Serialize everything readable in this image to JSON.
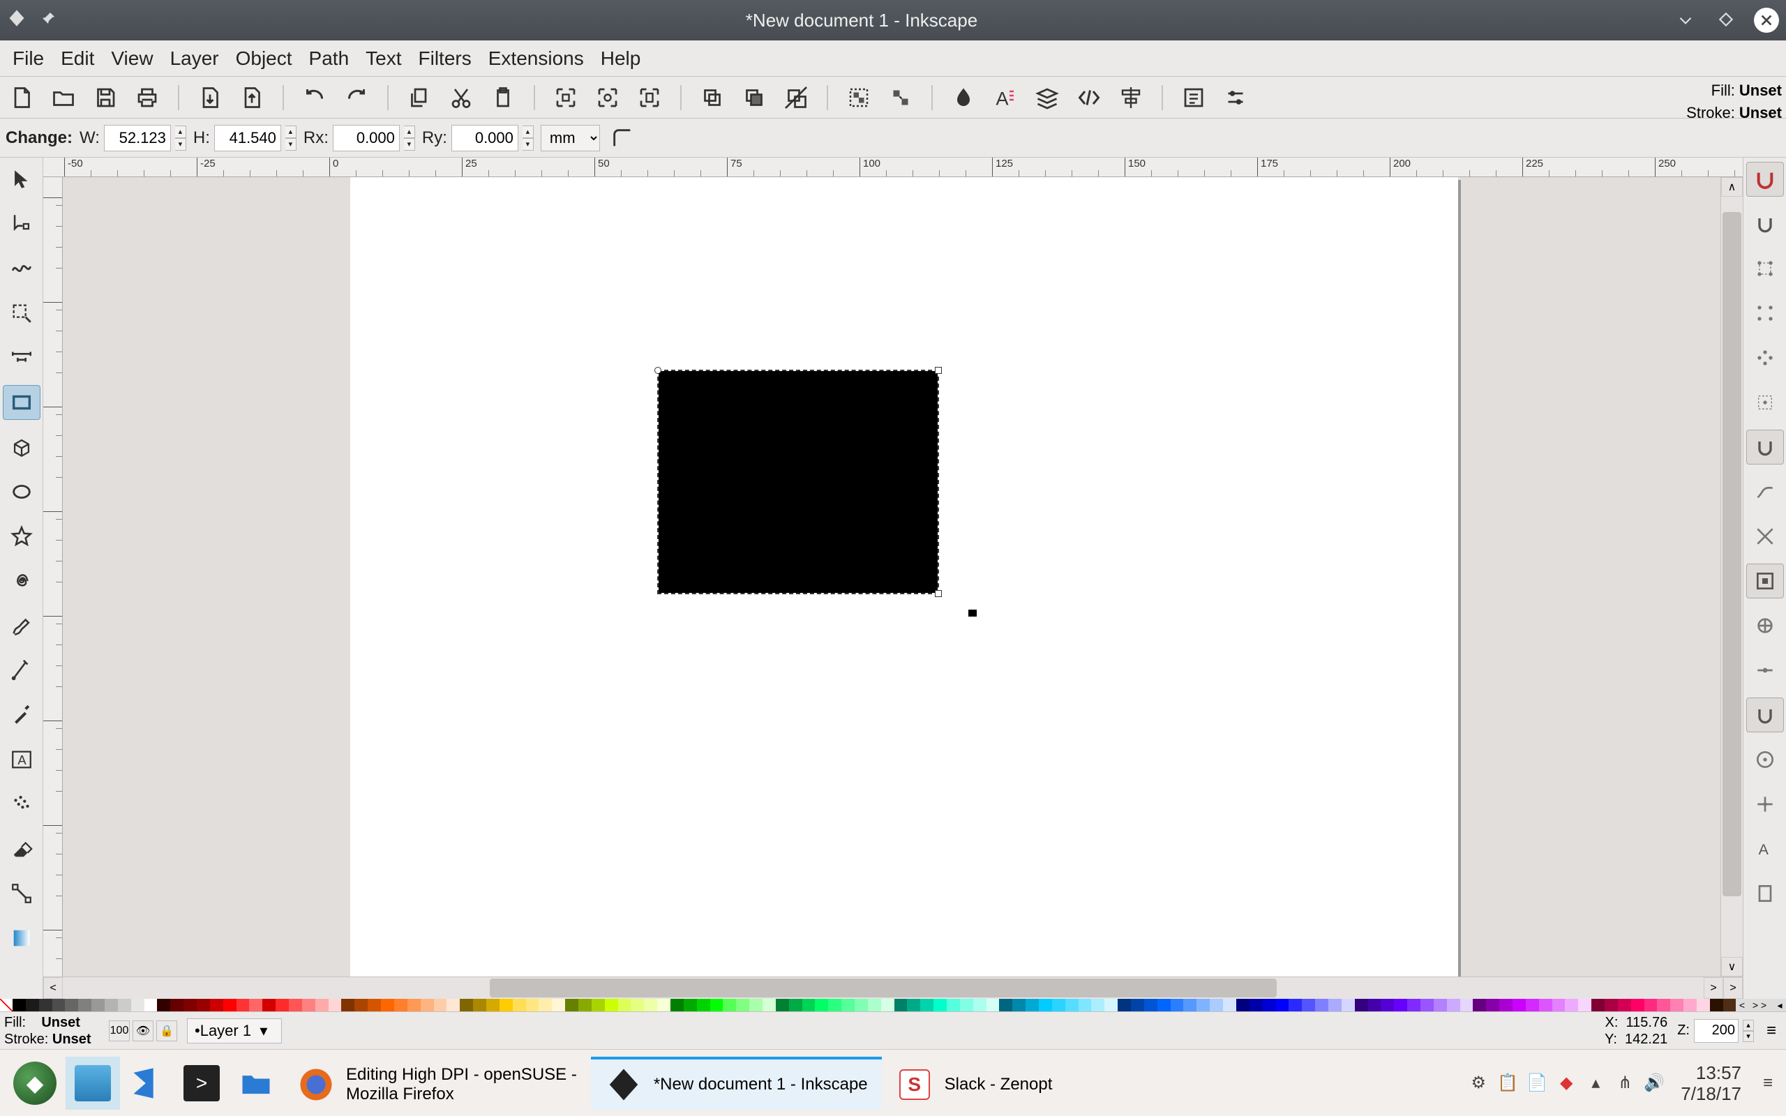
{
  "title": "*New document 1 - Inkscape",
  "menus": [
    "File",
    "Edit",
    "View",
    "Layer",
    "Object",
    "Path",
    "Text",
    "Filters",
    "Extensions",
    "Help"
  ],
  "options": {
    "change": "Change:",
    "w_lbl": "W:",
    "w": "52.123",
    "h_lbl": "H:",
    "h": "41.540",
    "rx_lbl": "Rx:",
    "rx": "0.000",
    "ry_lbl": "Ry:",
    "ry": "0.000",
    "unit": "mm"
  },
  "fill_lbl": "Fill:",
  "stroke_lbl": "Stroke:",
  "unset": "Unset",
  "status": {
    "fill_lbl": "Fill:",
    "fill": "Unset",
    "stroke_lbl": "Stroke:",
    "stroke": "Unset",
    "opacity": "100",
    "layer": "•Layer 1",
    "x_lbl": "X:",
    "x": "115.76",
    "y_lbl": "Y:",
    "y": "142.21",
    "z_lbl": "Z:",
    "z": "200"
  },
  "taskbar": {
    "firefox_l1": "Editing High DPI - openSUSE -",
    "firefox_l2": "Mozilla Firefox",
    "inkscape": "*New document 1 - Inkscape",
    "slack": "Slack - Zenopt",
    "time": "13:57",
    "date": "7/18/17"
  },
  "ruler_h": [
    "-50",
    "-25",
    "0",
    "25",
    "50",
    "75",
    "100",
    "125",
    "150",
    "175",
    "200",
    "225",
    "250"
  ],
  "palette_hex": [
    "#000000",
    "#1a1a1a",
    "#333333",
    "#4d4d4d",
    "#666666",
    "#808080",
    "#999999",
    "#b3b3b3",
    "#cccccc",
    "#e6e6e6",
    "#ffffff",
    "#330000",
    "#660000",
    "#800000",
    "#990000",
    "#cc0000",
    "#ff0000",
    "#ff3333",
    "#ff6666",
    "#d40000",
    "#ff2a2a",
    "#ff5555",
    "#ff8080",
    "#ffaaaa",
    "#ffd5d5",
    "#803300",
    "#aa4400",
    "#d45500",
    "#ff6600",
    "#ff7f2a",
    "#ff9955",
    "#ffb380",
    "#ffccaa",
    "#ffe6d5",
    "#806600",
    "#aa8800",
    "#d4aa00",
    "#ffcc00",
    "#ffdd55",
    "#ffe680",
    "#ffeeaa",
    "#fff6d5",
    "#668000",
    "#88aa00",
    "#aad400",
    "#ccff00",
    "#ddff55",
    "#e5ff80",
    "#eeffaa",
    "#f6ffd5",
    "#008000",
    "#00aa00",
    "#00d400",
    "#00ff00",
    "#55ff55",
    "#80ff80",
    "#aaffaa",
    "#d5ffd5",
    "#008033",
    "#00aa44",
    "#00d455",
    "#00ff66",
    "#2aff80",
    "#55ff99",
    "#80ffb3",
    "#aaffcc",
    "#d5ffe6",
    "#008066",
    "#00aa88",
    "#00d4aa",
    "#00ffcc",
    "#55ffdd",
    "#80ffe6",
    "#aaffee",
    "#d5fff6",
    "#006680",
    "#0088aa",
    "#00aad4",
    "#00ccff",
    "#2ad4ff",
    "#55ddff",
    "#80e5ff",
    "#aaeeff",
    "#d5f6ff",
    "#003380",
    "#0044aa",
    "#0055d4",
    "#0066ff",
    "#2a7fff",
    "#5599ff",
    "#80b3ff",
    "#aaccff",
    "#d5e5ff",
    "#000080",
    "#0000aa",
    "#0000d4",
    "#0000ff",
    "#2a2aff",
    "#5555ff",
    "#8080ff",
    "#aaaaff",
    "#d5d5ff",
    "#330080",
    "#4400aa",
    "#5500d4",
    "#6600ff",
    "#7f2aff",
    "#9955ff",
    "#b380ff",
    "#ccaaff",
    "#e5d5ff",
    "#660080",
    "#8800aa",
    "#aa00d4",
    "#cc00ff",
    "#d42aff",
    "#dd55ff",
    "#e580ff",
    "#eeaaff",
    "#f6d5ff",
    "#800033",
    "#aa0044",
    "#d40055",
    "#ff0066",
    "#ff2a80",
    "#ff5599",
    "#ff80b3",
    "#ffaacc",
    "#ffd5e5",
    "#2b1100",
    "#502d16"
  ]
}
